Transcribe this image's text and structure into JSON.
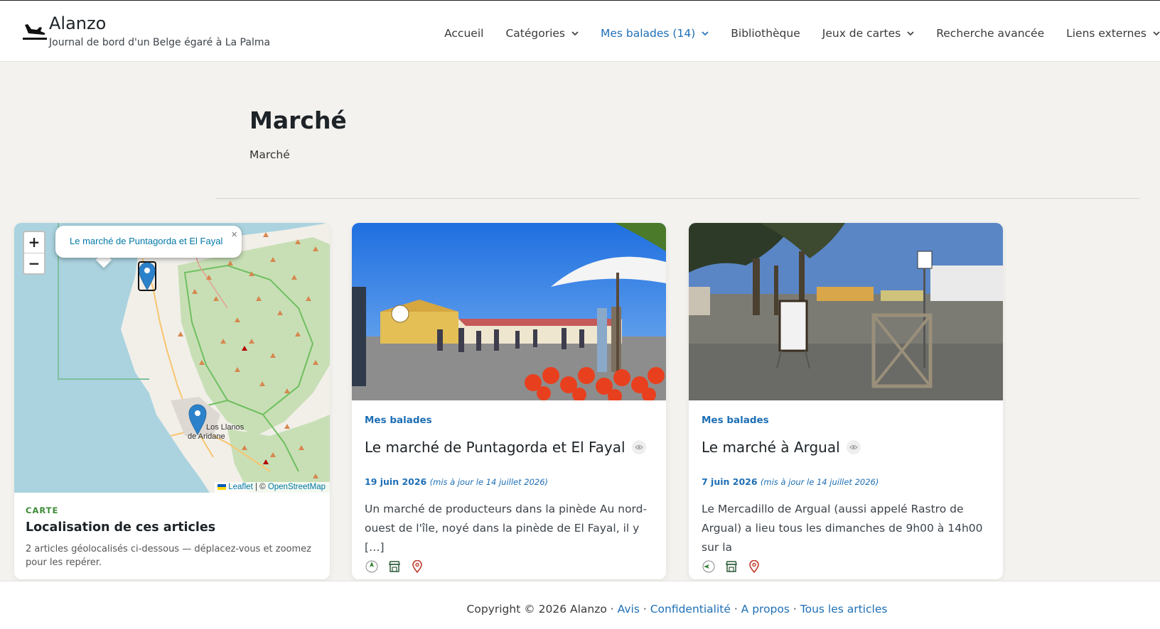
{
  "site": {
    "title": "Alanzo",
    "tagline": "Journal de bord d'un Belge égaré à La Palma",
    "icon": "airplane-landing-icon"
  },
  "nav": [
    {
      "label": "Accueil",
      "dropdown": false
    },
    {
      "label": "Catégories",
      "dropdown": true
    },
    {
      "label": "Mes balades (14)",
      "dropdown": true,
      "active": true
    },
    {
      "label": "Bibliothèque",
      "dropdown": false
    },
    {
      "label": "Jeux de cartes",
      "dropdown": true
    },
    {
      "label": "Recherche avancée",
      "dropdown": false
    },
    {
      "label": "Liens externes",
      "dropdown": true
    }
  ],
  "page": {
    "title": "Marché",
    "description": "Marché"
  },
  "map_card": {
    "zoom_in": "+",
    "zoom_out": "−",
    "popup_text": "Le marché de Puntagorda et El Fayal",
    "popup_close": "×",
    "place_label_1": "Los Llanos",
    "place_label_2": "de Aridane",
    "attribution_leaflet": "Leaflet",
    "attribution_sep": " | © ",
    "attribution_osm": "OpenStreetMap",
    "label": "CARTE",
    "heading": "Localisation de ces articles",
    "text": "2 articles géolocalisés ci-dessous — déplacez-vous et zoomez pour les repérer."
  },
  "posts": [
    {
      "category": "Mes balades",
      "title": "Le marché de Puntagorda et El Fayal",
      "date": "19 juin 2026",
      "updated": "(mis à jour le 14 juillet 2026)",
      "excerpt": "Un marché de producteurs dans la pinède Au nord-ouest de l'île, noyé dans la pinède de El Fayal, il y […]",
      "icons": [
        "direction-north-icon",
        "shop-icon",
        "location-pin-icon"
      ]
    },
    {
      "category": "Mes balades",
      "title": "Le marché à Argual",
      "date": "7 juin 2026",
      "updated": "(mis à jour le 14 juillet 2026)",
      "excerpt": "Le Mercadillo de Argual (aussi appelé Rastro de Argual) a lieu tous les dimanches de 9h00 à 14h00 sur la",
      "icons": [
        "direction-west-icon",
        "shop-icon",
        "location-pin-icon"
      ]
    }
  ],
  "footer": {
    "copyright": "Copyright © 2026 Alanzo · ",
    "links": [
      "Avis",
      "Confidentialité",
      "A propos",
      "Tous les articles"
    ],
    "separator": " · "
  },
  "colors": {
    "accent": "#1e6fb5",
    "map_label": "#3d8b37",
    "pin_red": "#c0392b"
  }
}
